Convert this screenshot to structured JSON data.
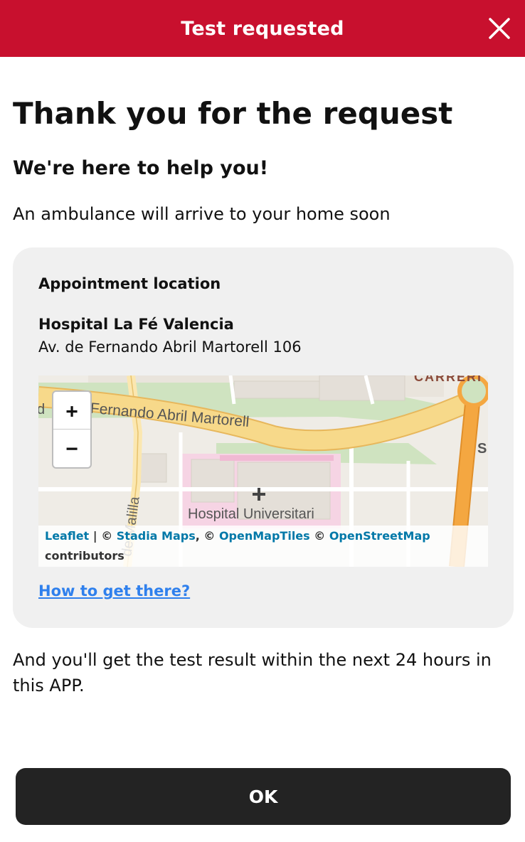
{
  "header": {
    "title": "Test requested",
    "close_icon": "close-icon"
  },
  "main": {
    "title": "Thank you for the request",
    "subtitle": "We're here to help you!",
    "message": "An ambulance will arrive to your home soon",
    "footnote": "And you'll get the test result within the next 24 hours in this APP."
  },
  "appointment": {
    "heading": "Appointment location",
    "hospital_name": "Hospital La Fé Valencia",
    "address": "Av. de Fernando Abril Martorell 106",
    "directions_link": "How to get there?"
  },
  "map": {
    "zoom_in": "+",
    "zoom_out": "−",
    "street_label": "Fernando Abril Martorell",
    "street_label_left": "d",
    "side_street_label": "de Malilla",
    "hospital_label": "Hospital Universitari",
    "top_label": "CARRERI",
    "right_label": "S",
    "attribution": {
      "leaflet": "Leaflet",
      "sep1": " | © ",
      "stadia": "Stadia Maps",
      "sep2": ", © ",
      "openmaptiles": "OpenMapTiles",
      "sep3": " © ",
      "osm": "OpenStreetMap",
      "contributors": "contributors"
    },
    "colors": {
      "road_major": "#f7d98a",
      "road_major_edge": "#e7b75c",
      "road_orange": "#f4a741",
      "green": "#cfe3c0",
      "hospital_pink": "#f6d4e4",
      "building": "#e4dfd8"
    }
  },
  "footer": {
    "ok_label": "OK"
  },
  "colors": {
    "header_bg": "#c8102e",
    "button_bg": "#232323",
    "link": "#2f80ed",
    "card_bg": "#f0f0f0"
  }
}
